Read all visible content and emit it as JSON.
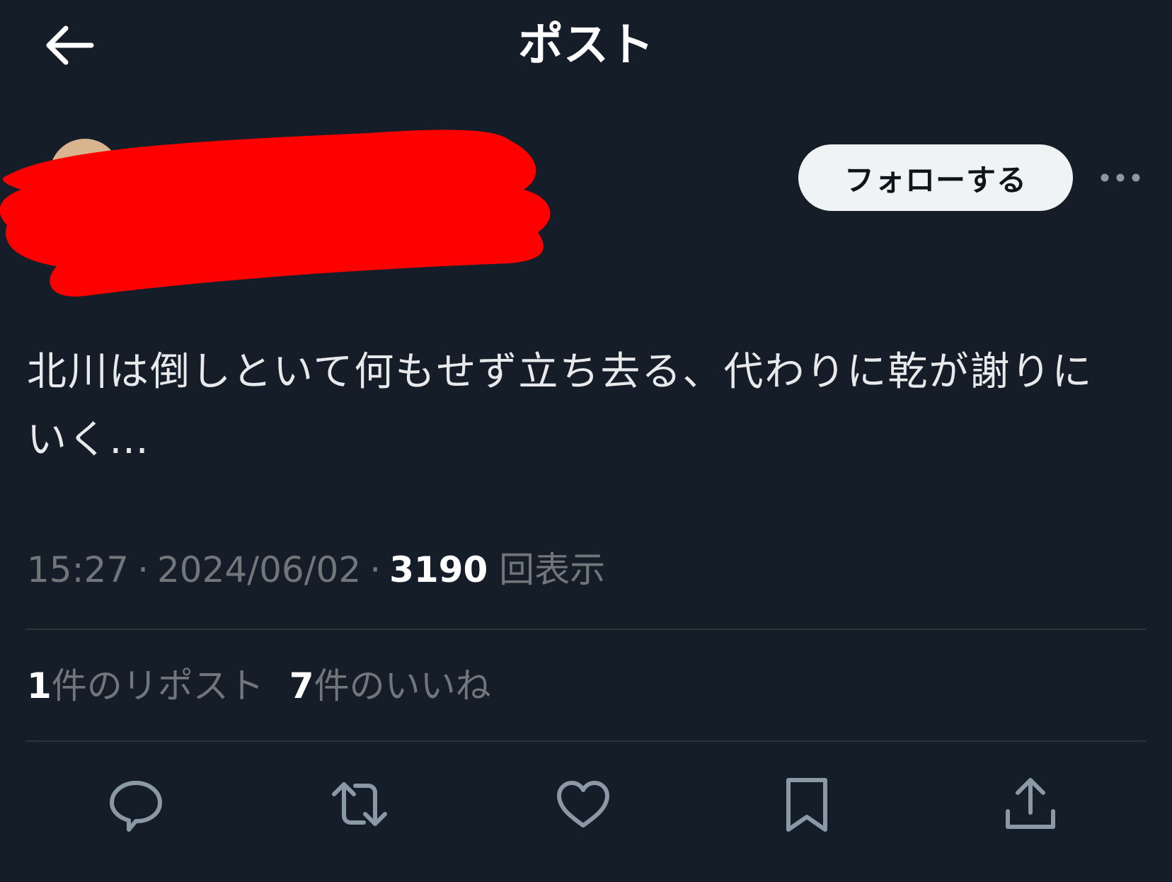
{
  "header": {
    "title": "ポスト"
  },
  "author": {
    "follow_label": "フォローする"
  },
  "post": {
    "text": "北川は倒しといて何もせず立ち去る、代わりに乾が謝りにいく…",
    "time": "15:27",
    "date": "2024/06/02",
    "views_count": "3190",
    "views_label": "回表示"
  },
  "stats": {
    "reposts_count": "1",
    "reposts_label": "件のリポスト",
    "likes_count": "7",
    "likes_label": "件のいいね"
  },
  "actions": [
    "reply-icon",
    "repost-icon",
    "like-icon",
    "bookmark-icon",
    "share-icon"
  ],
  "colors": {
    "background": "#151d28",
    "text": "#e7e9ea",
    "secondary_text": "#71767b",
    "icon": "#8b98a5",
    "follow_button_bg": "#eff3f4",
    "redaction": "#ff0000"
  }
}
